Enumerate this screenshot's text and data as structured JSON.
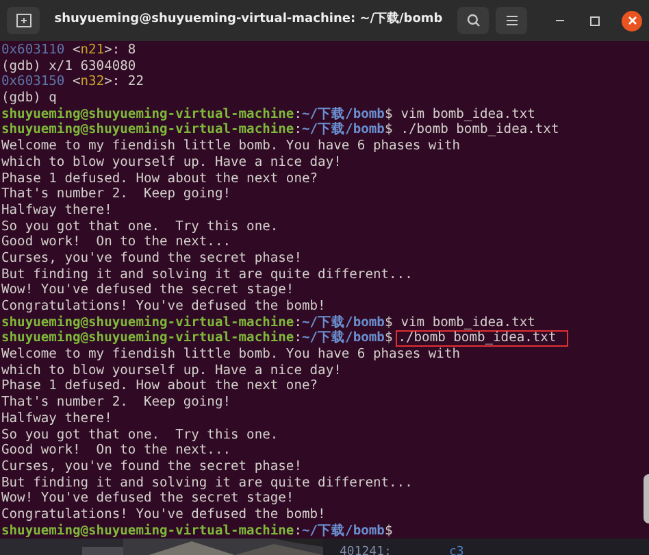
{
  "window": {
    "title": "shuyueming@shuyueming-virtual-machine: ~/下载/bomb"
  },
  "lines": [
    {
      "kind": "output",
      "segments": [
        {
          "text": "0x603110",
          "kind": "address"
        },
        {
          "text": " <",
          "kind": "plain"
        },
        {
          "text": "n21",
          "kind": "symbol"
        },
        {
          "text": ">: 8",
          "kind": "plain"
        }
      ]
    },
    {
      "kind": "output",
      "segments": [
        {
          "text": "(gdb) x/1 6304080",
          "kind": "plain"
        }
      ]
    },
    {
      "kind": "output",
      "segments": [
        {
          "text": "0x603150",
          "kind": "address"
        },
        {
          "text": " <",
          "kind": "plain"
        },
        {
          "text": "n32",
          "kind": "symbol"
        },
        {
          "text": ">: 22",
          "kind": "plain"
        }
      ]
    },
    {
      "kind": "output",
      "segments": [
        {
          "text": "(gdb) q",
          "kind": "plain"
        }
      ]
    },
    {
      "kind": "prompt",
      "prompt": [
        {
          "text": "shuyueming@shuyueming-virtual-machine",
          "kind": "user"
        },
        {
          "text": ":",
          "kind": "plain"
        },
        {
          "text": "~/下载/bomb",
          "kind": "path"
        },
        {
          "text": "$",
          "kind": "plain"
        }
      ],
      "command": "vim bomb_idea.txt",
      "highlighted": false
    },
    {
      "kind": "prompt",
      "prompt": [
        {
          "text": "shuyueming@shuyueming-virtual-machine",
          "kind": "user"
        },
        {
          "text": ":",
          "kind": "plain"
        },
        {
          "text": "~/下载/bomb",
          "kind": "path"
        },
        {
          "text": "$",
          "kind": "plain"
        }
      ],
      "command": "./bomb bomb_idea.txt",
      "highlighted": false
    },
    {
      "kind": "output",
      "segments": [
        {
          "text": "Welcome to my fiendish little bomb. You have 6 phases with",
          "kind": "plain"
        }
      ]
    },
    {
      "kind": "output",
      "segments": [
        {
          "text": "which to blow yourself up. Have a nice day!",
          "kind": "plain"
        }
      ]
    },
    {
      "kind": "output",
      "segments": [
        {
          "text": "Phase 1 defused. How about the next one?",
          "kind": "plain"
        }
      ]
    },
    {
      "kind": "output",
      "segments": [
        {
          "text": "That's number 2.  Keep going!",
          "kind": "plain"
        }
      ]
    },
    {
      "kind": "output",
      "segments": [
        {
          "text": "Halfway there!",
          "kind": "plain"
        }
      ]
    },
    {
      "kind": "output",
      "segments": [
        {
          "text": "So you got that one.  Try this one.",
          "kind": "plain"
        }
      ]
    },
    {
      "kind": "output",
      "segments": [
        {
          "text": "Good work!  On to the next...",
          "kind": "plain"
        }
      ]
    },
    {
      "kind": "output",
      "segments": [
        {
          "text": "Curses, you've found the secret phase!",
          "kind": "plain"
        }
      ]
    },
    {
      "kind": "output",
      "segments": [
        {
          "text": "But finding it and solving it are quite different...",
          "kind": "plain"
        }
      ]
    },
    {
      "kind": "output",
      "segments": [
        {
          "text": "Wow! You've defused the secret stage!",
          "kind": "plain"
        }
      ]
    },
    {
      "kind": "output",
      "segments": [
        {
          "text": "Congratulations! You've defused the bomb!",
          "kind": "plain"
        }
      ]
    },
    {
      "kind": "prompt",
      "prompt": [
        {
          "text": "shuyueming@shuyueming-virtual-machine",
          "kind": "user"
        },
        {
          "text": ":",
          "kind": "plain"
        },
        {
          "text": "~/下载/bomb",
          "kind": "path"
        },
        {
          "text": "$",
          "kind": "plain"
        }
      ],
      "command": "vim bomb_idea.txt",
      "highlighted": false
    },
    {
      "kind": "prompt",
      "prompt": [
        {
          "text": "shuyueming@shuyueming-virtual-machine",
          "kind": "user"
        },
        {
          "text": ":",
          "kind": "plain"
        },
        {
          "text": "~/下载/bomb",
          "kind": "path"
        },
        {
          "text": "$",
          "kind": "plain"
        }
      ],
      "command": "./bomb bomb_idea.txt",
      "highlighted": true
    },
    {
      "kind": "output",
      "segments": [
        {
          "text": "Welcome to my fiendish little bomb. You have 6 phases with",
          "kind": "plain"
        }
      ]
    },
    {
      "kind": "output",
      "segments": [
        {
          "text": "which to blow yourself up. Have a nice day!",
          "kind": "plain"
        }
      ]
    },
    {
      "kind": "output",
      "segments": [
        {
          "text": "Phase 1 defused. How about the next one?",
          "kind": "plain"
        }
      ]
    },
    {
      "kind": "output",
      "segments": [
        {
          "text": "That's number 2.  Keep going!",
          "kind": "plain"
        }
      ]
    },
    {
      "kind": "output",
      "segments": [
        {
          "text": "Halfway there!",
          "kind": "plain"
        }
      ]
    },
    {
      "kind": "output",
      "segments": [
        {
          "text": "So you got that one.  Try this one.",
          "kind": "plain"
        }
      ]
    },
    {
      "kind": "output",
      "segments": [
        {
          "text": "Good work!  On to the next...",
          "kind": "plain"
        }
      ]
    },
    {
      "kind": "output",
      "segments": [
        {
          "text": "Curses, you've found the secret phase!",
          "kind": "plain"
        }
      ]
    },
    {
      "kind": "output",
      "segments": [
        {
          "text": "But finding it and solving it are quite different...",
          "kind": "plain"
        }
      ]
    },
    {
      "kind": "output",
      "segments": [
        {
          "text": "Wow! You've defused the secret stage!",
          "kind": "plain"
        }
      ]
    },
    {
      "kind": "output",
      "segments": [
        {
          "text": "Congratulations! You've defused the bomb!",
          "kind": "plain"
        }
      ]
    },
    {
      "kind": "prompt",
      "prompt": [
        {
          "text": "shuyueming@shuyueming-virtual-machine",
          "kind": "user"
        },
        {
          "text": ":",
          "kind": "plain"
        },
        {
          "text": "~/下载/bomb",
          "kind": "path"
        },
        {
          "text": "$",
          "kind": "plain"
        }
      ]
    }
  ],
  "background_window": {
    "column_1": "401241:",
    "column_2": "c3"
  }
}
